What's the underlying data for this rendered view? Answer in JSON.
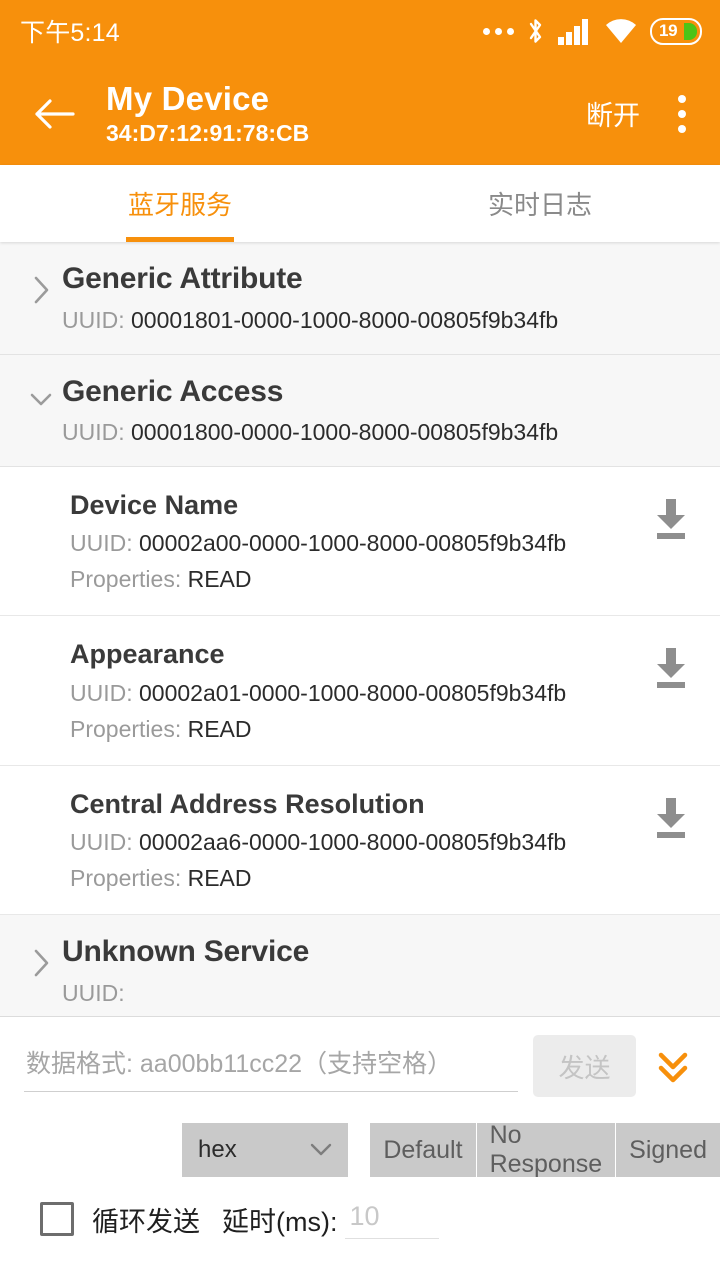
{
  "statusbar": {
    "time": "下午5:14",
    "icons": [
      "more-dots-icon",
      "bluetooth-icon",
      "cellular-signal-icon",
      "wifi-icon",
      "battery-icon"
    ],
    "battery_level": "19"
  },
  "appbar": {
    "back_icon": "back-arrow-icon",
    "title": "My Device",
    "subtitle": "34:D7:12:91:78:CB",
    "action_label": "断开",
    "overflow_icon": "kebab-menu-icon",
    "background": "#F7900C"
  },
  "tabs": [
    {
      "label": "蓝牙服务",
      "active": true
    },
    {
      "label": "实时日志",
      "active": false
    }
  ],
  "services": [
    {
      "name": "Generic Attribute",
      "uuid_label": "UUID:",
      "uuid": "00001801-0000-1000-8000-00805f9b34fb",
      "expanded": false,
      "chevron": "chevron-right-icon",
      "characteristics": []
    },
    {
      "name": "Generic Access",
      "uuid_label": "UUID:",
      "uuid": "00001800-0000-1000-8000-00805f9b34fb",
      "expanded": true,
      "chevron": "chevron-down-icon",
      "characteristics": [
        {
          "name": "Device Name",
          "uuid_label": "UUID:",
          "uuid": "00002a00-0000-1000-8000-00805f9b34fb",
          "props_label": "Properties:",
          "props": "READ",
          "action_icon": "download-icon"
        },
        {
          "name": "Appearance",
          "uuid_label": "UUID:",
          "uuid": "00002a01-0000-1000-8000-00805f9b34fb",
          "props_label": "Properties:",
          "props": "READ",
          "action_icon": "download-icon"
        },
        {
          "name": "Central Address Resolution",
          "uuid_label": "UUID:",
          "uuid": "00002aa6-0000-1000-8000-00805f9b34fb",
          "props_label": "Properties:",
          "props": "READ",
          "action_icon": "download-icon"
        }
      ]
    },
    {
      "name": "Unknown Service",
      "uuid_label": "UUID:",
      "uuid": "",
      "expanded": false,
      "chevron": "chevron-right-icon",
      "characteristics": []
    }
  ],
  "bottom_panel": {
    "data_input": {
      "value": "",
      "placeholder": "数据格式: aa00bb11cc22（支持空格）"
    },
    "send_button": {
      "label": "发送",
      "disabled": true
    },
    "collapse_icon": "double-chevron-down-icon",
    "format_select": {
      "value": "hex",
      "chevron": "chevron-down-icon"
    },
    "write_modes": [
      "Default",
      "No Response",
      "Signed"
    ],
    "loop": {
      "checkbox_checked": false,
      "label": "循环发送",
      "delay_label": "延时(ms):",
      "delay_value": "",
      "delay_placeholder": "10"
    }
  },
  "colors": {
    "accent": "#F7900C",
    "panel_bg": "#F7F7F7",
    "segment_bg": "#C9C9C9"
  }
}
